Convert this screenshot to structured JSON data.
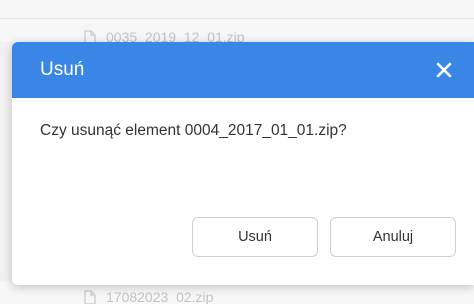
{
  "background_list": {
    "items": [
      {
        "name": "0035_2019_12_01.zip"
      },
      {
        "name": "17082023_02.zip"
      }
    ]
  },
  "dialog": {
    "title": "Usuń",
    "message": "Czy usunąć element 0004_2017_01_01.zip?",
    "confirm_label": "Usuń",
    "cancel_label": "Anuluj",
    "close_icon": "close-icon"
  },
  "colors": {
    "header_bg": "#3a86e6",
    "header_text": "#ffffff",
    "body_text": "#333333"
  }
}
